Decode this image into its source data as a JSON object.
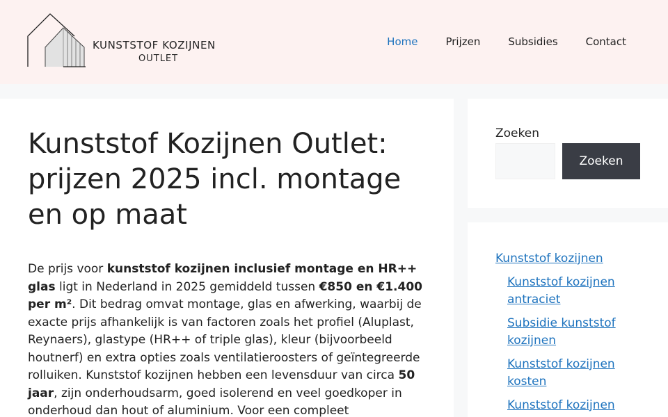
{
  "header": {
    "logo": {
      "line1": "KUNSTSTOF KOZIJNEN",
      "line2": "OUTLET"
    },
    "nav": [
      {
        "label": "Home",
        "active": true
      },
      {
        "label": "Prijzen",
        "active": false
      },
      {
        "label": "Subsidies",
        "active": false
      },
      {
        "label": "Contact",
        "active": false
      }
    ]
  },
  "article": {
    "title": "Kunststof Kozijnen Outlet: prijzen 2025 incl. montage en op maat",
    "intro": [
      {
        "text": "De prijs voor ",
        "bold": false
      },
      {
        "text": "kunststof kozijnen inclusief montage en HR++ glas",
        "bold": true
      },
      {
        "text": " ligt in Nederland in 2025 gemiddeld tussen ",
        "bold": false
      },
      {
        "text": "€850 en €1.400 per m²",
        "bold": true
      },
      {
        "text": ". Dit bedrag omvat montage, glas en afwerking, waarbij de exacte prijs afhankelijk is van factoren zoals het profiel (Aluplast, Reynaers), glastype (HR++ of triple glas), kleur (bijvoorbeeld houtnerf) en extra opties zoals ventilatieroosters of geïntegreerde rolluiken. Kunststof kozijnen hebben een levensduur van circa ",
        "bold": false
      },
      {
        "text": "50 jaar",
        "bold": true
      },
      {
        "text": ", zijn onderhoudsarm, goed isolerend en veel goedkoper in onderhoud dan hout of aluminium. Voor een compleet",
        "bold": false
      }
    ]
  },
  "sidebar": {
    "search": {
      "label": "Zoeken",
      "button": "Zoeken",
      "placeholder": ""
    },
    "links": {
      "top": "Kunststof kozijnen",
      "sub": [
        "Kunststof kozijnen antraciet",
        "Subsidie kunststof kozijnen",
        "Kunststof kozijnen kosten",
        "Kunststof kozijnen"
      ]
    }
  },
  "colors": {
    "header_bg": "#fdf2f1",
    "link": "#1e73be",
    "button_bg": "#3a3d45",
    "page_bg": "#f7f8f9"
  }
}
